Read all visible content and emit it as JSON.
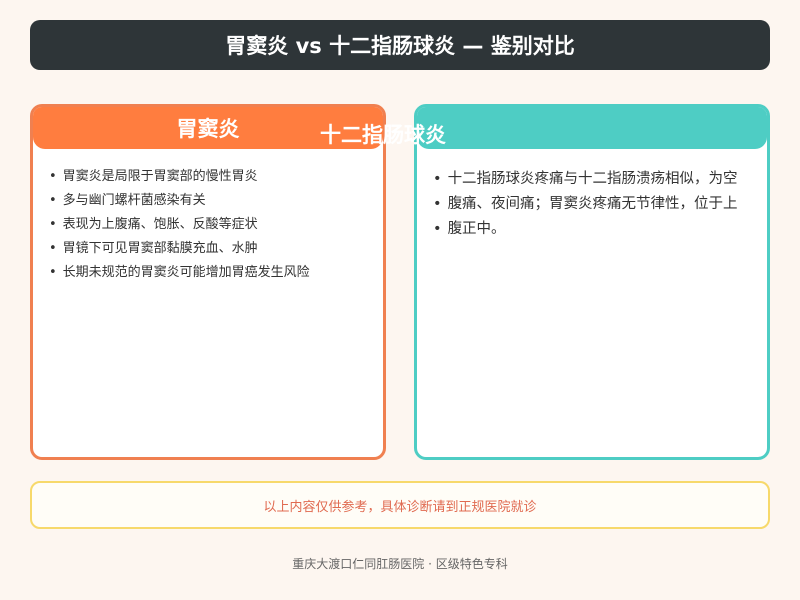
{
  "title": "胃窦炎 vs 十二指肠球炎 — 鉴别对比",
  "left_card": {
    "heading": "胃窦炎",
    "items": [
      "胃窦炎是局限于胃窦部的慢性胃炎",
      "多与幽门螺杆菌感染有关",
      "表现为上腹痛、饱胀、反酸等症状",
      "胃镜下可见胃窦部黏膜充血、水肿",
      "长期未规范的胃窦炎可能增加胃癌发生风险"
    ]
  },
  "right_card": {
    "heading": "十二指肠球炎",
    "lines": [
      "十二指肠球炎疼痛与十二指肠溃疡相似，为空",
      "腹痛、夜间痛；胃窦炎疼痛无节律性，位于上",
      "腹正中。"
    ]
  },
  "notice": "以上内容仅供参考，具体诊断请到正规医院就诊",
  "footer": "重庆大渡口仁同肛肠医院 · 区级特色专科",
  "colors": {
    "title_bg": "#2e3538",
    "left_accent": "#ff7d3f",
    "right_accent": "#4ecdc4",
    "notice_border": "#f7d96b",
    "notice_text": "#e06a50"
  }
}
